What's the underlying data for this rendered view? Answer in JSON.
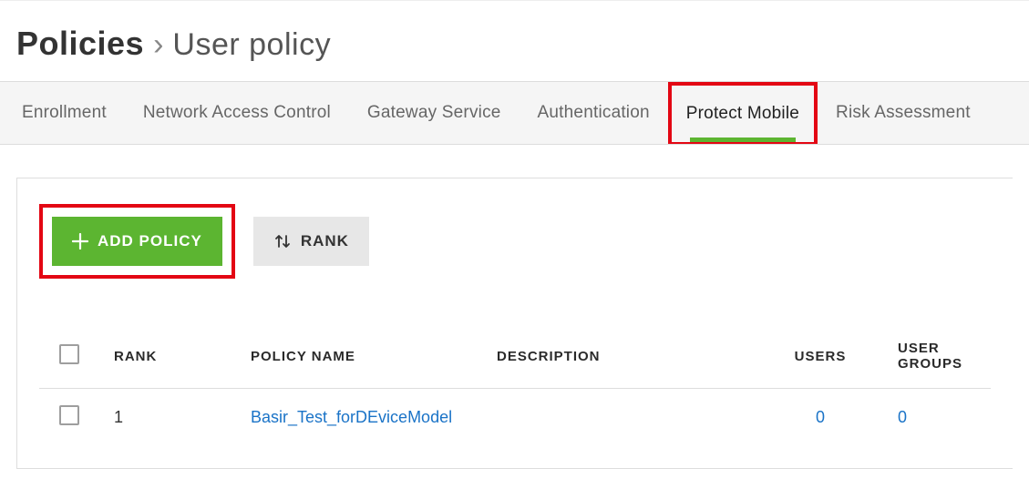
{
  "breadcrumb": {
    "root": "Policies",
    "sep": "›",
    "current": "User policy"
  },
  "tabs": [
    {
      "label": "Enrollment"
    },
    {
      "label": "Network Access Control"
    },
    {
      "label": "Gateway Service"
    },
    {
      "label": "Authentication"
    },
    {
      "label": "Protect Mobile"
    },
    {
      "label": "Risk Assessment"
    }
  ],
  "actions": {
    "add_policy": "ADD POLICY",
    "rank": "RANK"
  },
  "table": {
    "headers": {
      "rank": "RANK",
      "policy_name": "POLICY NAME",
      "description": "DESCRIPTION",
      "users": "USERS",
      "user_groups": "USER GROUPS"
    },
    "rows": [
      {
        "rank": "1",
        "policy_name": "Basir_Test_forDEviceModel",
        "description": "",
        "users": "0",
        "user_groups": "0"
      }
    ]
  }
}
